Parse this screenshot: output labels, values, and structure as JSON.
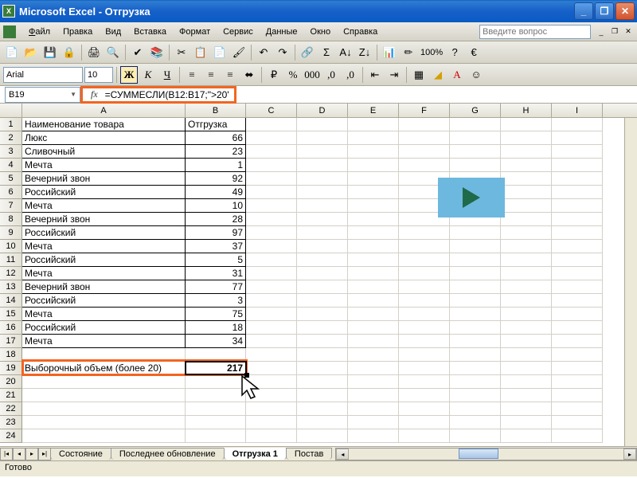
{
  "titlebar": {
    "app": "Microsoft Excel",
    "doc": "Отгрузка"
  },
  "menu": {
    "file": "Файл",
    "edit": "Правка",
    "view": "Вид",
    "insert": "Вставка",
    "format": "Формат",
    "tools": "Сервис",
    "data": "Данные",
    "window": "Окно",
    "help": "Справка"
  },
  "helpPlaceholder": "Введите вопрос",
  "font": {
    "name": "Arial",
    "size": "10"
  },
  "zoom": "100%",
  "nameBox": "B19",
  "formula": "=СУММЕСЛИ(B12:B17;\">20\")",
  "columns": [
    "A",
    "B",
    "C",
    "D",
    "E",
    "F",
    "G",
    "H",
    "I"
  ],
  "headerRow": {
    "A": "Наименование товара",
    "B": "Отгрузка"
  },
  "rows": [
    {
      "n": 2,
      "A": "Люкс",
      "B": 66
    },
    {
      "n": 3,
      "A": "Сливочный",
      "B": 23
    },
    {
      "n": 4,
      "A": "Мечта",
      "B": 1
    },
    {
      "n": 5,
      "A": "Вечерний звон",
      "B": 92
    },
    {
      "n": 6,
      "A": "Российский",
      "B": 49
    },
    {
      "n": 7,
      "A": "Мечта",
      "B": 10
    },
    {
      "n": 8,
      "A": "Вечерний звон",
      "B": 28
    },
    {
      "n": 9,
      "A": "Российский",
      "B": 97
    },
    {
      "n": 10,
      "A": "Мечта",
      "B": 37
    },
    {
      "n": 11,
      "A": "Российский",
      "B": 5
    },
    {
      "n": 12,
      "A": "Мечта",
      "B": 31
    },
    {
      "n": 13,
      "A": "Вечерний звон",
      "B": 77
    },
    {
      "n": 14,
      "A": "Российский",
      "B": 3
    },
    {
      "n": 15,
      "A": "Мечта",
      "B": 75
    },
    {
      "n": 16,
      "A": "Российский",
      "B": 18
    },
    {
      "n": 17,
      "A": "Мечта",
      "B": 34
    }
  ],
  "summaryRow": {
    "n": 19,
    "A": "Выборочный объем (более 20)",
    "B": 217
  },
  "emptyRows": [
    20,
    21
  ],
  "tabs": {
    "t1": "Состояние",
    "t2": "Последнее обновление",
    "t3": "Отгрузка 1",
    "t4": "Постав"
  },
  "status": "Готово",
  "chart_data": {
    "type": "table",
    "title": "Отгрузка",
    "columns": [
      "Наименование товара",
      "Отгрузка"
    ],
    "rows": [
      [
        "Люкс",
        66
      ],
      [
        "Сливочный",
        23
      ],
      [
        "Мечта",
        1
      ],
      [
        "Вечерний звон",
        92
      ],
      [
        "Российский",
        49
      ],
      [
        "Мечта",
        10
      ],
      [
        "Вечерний звон",
        28
      ],
      [
        "Российский",
        97
      ],
      [
        "Мечта",
        37
      ],
      [
        "Российский",
        5
      ],
      [
        "Мечта",
        31
      ],
      [
        "Вечерний звон",
        77
      ],
      [
        "Российский",
        3
      ],
      [
        "Мечта",
        75
      ],
      [
        "Российский",
        18
      ],
      [
        "Мечта",
        34
      ]
    ],
    "summary": {
      "label": "Выборочный объем (более 20)",
      "value": 217,
      "formula": "=СУММЕСЛИ(B12:B17;\">20\")"
    }
  }
}
